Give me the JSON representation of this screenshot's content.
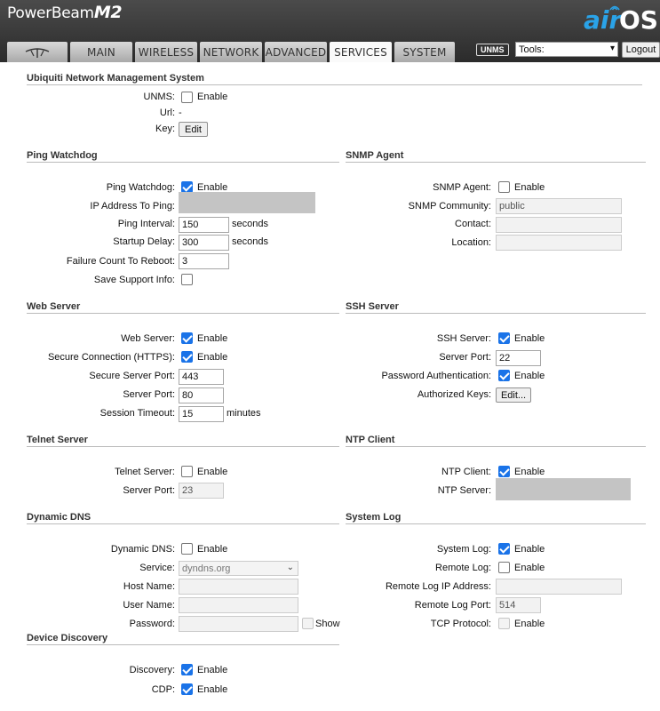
{
  "header": {
    "brand_prefix": "PowerBeam",
    "brand_model": "M2",
    "airos_air": "air",
    "airos_os": "OS",
    "unms_badge": "UNMS",
    "tools_value": "Tools:",
    "logout_label": "Logout"
  },
  "tabs": [
    "MAIN",
    "WIRELESS",
    "NETWORK",
    "ADVANCED",
    "SERVICES",
    "SYSTEM"
  ],
  "active_tab": "SERVICES",
  "enable_text": "Enable",
  "unms": {
    "title": "Ubiquiti Network Management System",
    "unms_label": "UNMS:",
    "unms_enabled": false,
    "url_label": "Url:",
    "url_value": "-",
    "key_label": "Key:",
    "edit_label": "Edit"
  },
  "ping_watchdog": {
    "title": "Ping Watchdog",
    "watchdog_label": "Ping Watchdog:",
    "watchdog_enabled": true,
    "ip_label": "IP Address To Ping:",
    "interval_label": "Ping Interval:",
    "interval_value": "150",
    "interval_unit": "seconds",
    "startup_label": "Startup Delay:",
    "startup_value": "300",
    "startup_unit": "seconds",
    "failure_label": "Failure Count To Reboot:",
    "failure_value": "3",
    "support_label": "Save Support Info:",
    "support_enabled": false
  },
  "snmp": {
    "title": "SNMP Agent",
    "agent_label": "SNMP Agent:",
    "agent_enabled": false,
    "community_label": "SNMP Community:",
    "community_value": "public",
    "contact_label": "Contact:",
    "contact_value": "",
    "location_label": "Location:",
    "location_value": ""
  },
  "web_server": {
    "title": "Web Server",
    "server_label": "Web Server:",
    "server_enabled": true,
    "https_label": "Secure Connection (HTTPS):",
    "https_enabled": true,
    "secure_port_label": "Secure Server Port:",
    "secure_port_value": "443",
    "port_label": "Server Port:",
    "port_value": "80",
    "timeout_label": "Session Timeout:",
    "timeout_value": "15",
    "timeout_unit": "minutes"
  },
  "ssh": {
    "title": "SSH Server",
    "server_label": "SSH Server:",
    "server_enabled": true,
    "port_label": "Server Port:",
    "port_value": "22",
    "pwauth_label": "Password Authentication:",
    "pwauth_enabled": true,
    "keys_label": "Authorized Keys:",
    "edit_label": "Edit..."
  },
  "telnet": {
    "title": "Telnet Server",
    "server_label": "Telnet Server:",
    "server_enabled": false,
    "port_label": "Server Port:",
    "port_value": "23"
  },
  "ntp": {
    "title": "NTP Client",
    "client_label": "NTP Client:",
    "client_enabled": true,
    "server_label": "NTP Server:"
  },
  "ddns": {
    "title": "Dynamic DNS",
    "ddns_label": "Dynamic DNS:",
    "ddns_enabled": false,
    "service_label": "Service:",
    "service_value": "dyndns.org",
    "host_label": "Host Name:",
    "host_value": "",
    "user_label": "User Name:",
    "user_value": "",
    "password_label": "Password:",
    "password_value": "",
    "show_label": "Show"
  },
  "syslog": {
    "title": "System Log",
    "log_label": "System Log:",
    "log_enabled": true,
    "remote_label": "Remote Log:",
    "remote_enabled": false,
    "remote_ip_label": "Remote Log IP Address:",
    "remote_ip_value": "",
    "remote_port_label": "Remote Log Port:",
    "remote_port_value": "514",
    "tcp_label": "TCP Protocol:",
    "tcp_enabled": false
  },
  "discovery": {
    "title": "Device Discovery",
    "discovery_label": "Discovery:",
    "discovery_enabled": true,
    "cdp_label": "CDP:",
    "cdp_enabled": true
  }
}
